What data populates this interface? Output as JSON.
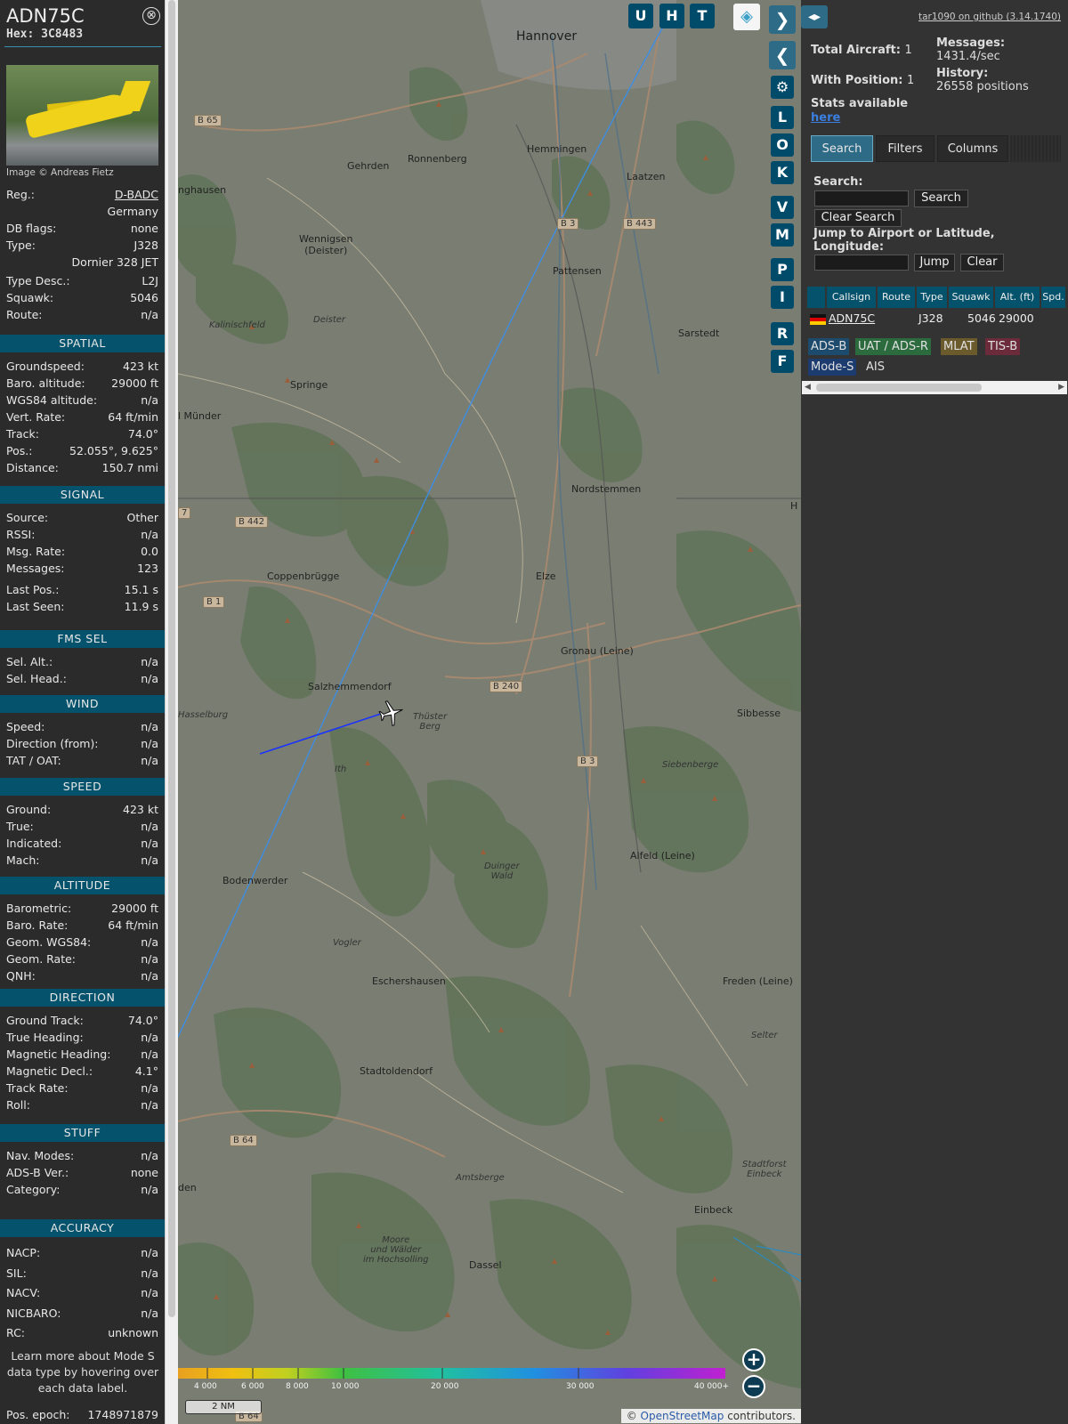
{
  "info": {
    "callsign": "ADN75C",
    "hex_label": "Hex:",
    "hex": "3C8483",
    "close_glyph": "⊗",
    "photo_credit": "Image © Andreas Fietz",
    "basic": [
      {
        "k": "Reg.:",
        "v": "D-BADC"
      },
      {
        "k": "",
        "v": "Germany"
      },
      {
        "k": "DB flags:",
        "v": "none"
      },
      {
        "k": "Type:",
        "v": "J328"
      },
      {
        "k": "",
        "v": "Dornier 328 JET"
      },
      {
        "k": "Type Desc.:",
        "v": "L2J"
      },
      {
        "k": "Squawk:",
        "v": "5046"
      },
      {
        "k": "Route:",
        "v": "n/a"
      }
    ],
    "sections": [
      {
        "title": "SPATIAL",
        "rows": [
          {
            "k": "Groundspeed:",
            "v": "423 kt"
          },
          {
            "k": "Baro. altitude:",
            "v": "29000 ft"
          },
          {
            "k": "WGS84 altitude:",
            "v": "n/a"
          },
          {
            "k": "Vert. Rate:",
            "v": "64 ft/min"
          },
          {
            "k": "Track:",
            "v": "74.0°"
          },
          {
            "k": "Pos.:",
            "v": "52.055°, 9.625°"
          },
          {
            "k": "Distance:",
            "v": "150.7 nmi"
          }
        ]
      },
      {
        "title": "SIGNAL",
        "rows": [
          {
            "k": "Source:",
            "v": "Other"
          },
          {
            "k": "RSSI:",
            "v": "n/a"
          },
          {
            "k": "Msg. Rate:",
            "v": "0.0"
          },
          {
            "k": "Messages:",
            "v": "123"
          },
          {
            "k": "Last Pos.:",
            "v": "15.1 s"
          },
          {
            "k": "Last Seen:",
            "v": "11.9 s"
          }
        ]
      },
      {
        "title": "FMS SEL",
        "rows": [
          {
            "k": "Sel. Alt.:",
            "v": "n/a"
          },
          {
            "k": "Sel. Head.:",
            "v": "n/a"
          }
        ]
      },
      {
        "title": "WIND",
        "rows": [
          {
            "k": "Speed:",
            "v": "n/a"
          },
          {
            "k": "Direction (from):",
            "v": "n/a"
          },
          {
            "k": "TAT / OAT:",
            "v": "n/a"
          }
        ]
      },
      {
        "title": "SPEED",
        "rows": [
          {
            "k": "Ground:",
            "v": "423 kt"
          },
          {
            "k": "True:",
            "v": "n/a"
          },
          {
            "k": "Indicated:",
            "v": "n/a"
          },
          {
            "k": "Mach:",
            "v": "n/a"
          }
        ]
      },
      {
        "title": "ALTITUDE",
        "rows": [
          {
            "k": "Barometric:",
            "v": "29000 ft"
          },
          {
            "k": "Baro. Rate:",
            "v": "64 ft/min"
          },
          {
            "k": "Geom. WGS84:",
            "v": "n/a"
          },
          {
            "k": "Geom. Rate:",
            "v": "n/a"
          },
          {
            "k": "QNH:",
            "v": "n/a"
          }
        ]
      },
      {
        "title": "DIRECTION",
        "rows": [
          {
            "k": "Ground Track:",
            "v": "74.0°"
          },
          {
            "k": "True Heading:",
            "v": "n/a"
          },
          {
            "k": "Magnetic Heading:",
            "v": "n/a"
          },
          {
            "k": "Magnetic Decl.:",
            "v": "4.1°"
          },
          {
            "k": "Track Rate:",
            "v": "n/a"
          },
          {
            "k": "Roll:",
            "v": "n/a"
          }
        ]
      },
      {
        "title": "STUFF",
        "rows": [
          {
            "k": "Nav. Modes:",
            "v": "n/a"
          },
          {
            "k": "ADS-B Ver.:",
            "v": "none"
          },
          {
            "k": "Category:",
            "v": "n/a"
          }
        ]
      },
      {
        "title": "ACCURACY",
        "rows": [
          {
            "k": "NACP:",
            "v": "n/a"
          },
          {
            "k": "SIL:",
            "v": "n/a"
          },
          {
            "k": "NACV:",
            "v": "n/a"
          },
          {
            "k": "NICBARO:",
            "v": "n/a"
          },
          {
            "k": "RC:",
            "v": "unknown"
          }
        ]
      }
    ],
    "learn_more": "Learn more about Mode S data type by hovering over each data label.",
    "epoch_label": "Pos. epoch:",
    "epoch_value": "1748971879"
  },
  "map": {
    "top_buttons": [
      "U",
      "H",
      "T"
    ],
    "side_buttons": [
      "L",
      "O",
      "K",
      "V",
      "M",
      "P",
      "I",
      "R",
      "F"
    ],
    "towns": [
      {
        "name": "Hannover",
        "big": true
      },
      {
        "name": "Hemmingen"
      },
      {
        "name": "Laatzen"
      },
      {
        "name": "Ronnenberg"
      },
      {
        "name": "Gehrden"
      },
      {
        "name": "nghausen"
      },
      {
        "name": "Wennigsen\n(Deister)"
      },
      {
        "name": "Pattensen"
      },
      {
        "name": "Sarstedt"
      },
      {
        "name": "Springe"
      },
      {
        "name": "l Münder"
      },
      {
        "name": "Nordstemmen"
      },
      {
        "name": "Coppenbrügge"
      },
      {
        "name": "Elze"
      },
      {
        "name": "Gronau (Leine)"
      },
      {
        "name": "Salzhemmendorf"
      },
      {
        "name": "Sibbesse"
      },
      {
        "name": "Alfeld (Leine)"
      },
      {
        "name": "Bodenwerder"
      },
      {
        "name": "Eschershausen"
      },
      {
        "name": "Freden (Leine)"
      },
      {
        "name": "Stadtoldendorf"
      },
      {
        "name": "Einbeck"
      },
      {
        "name": "Dassel"
      },
      {
        "name": "den"
      },
      {
        "name": "H"
      }
    ],
    "areas": [
      "Kalinischfeld",
      "Deister",
      "Hasselburg",
      "Thüster\nBerg",
      "Ith",
      "Siebenberge",
      "Duinger\nWald",
      "Vogler",
      "Selter",
      "Amtsberge",
      "Stadtforst\nEinbeck",
      "Moore\nund Wälder\nim Hochsolling"
    ],
    "roads": [
      "B 65",
      "B 3",
      "B 443",
      "B 442",
      "B 1",
      "B 240",
      "B 3",
      "B 64",
      "B 64",
      "7"
    ],
    "alt_labels": [
      "4 000",
      "6 000",
      "8 000",
      "10 000",
      "20 000",
      "30 000",
      "40 000+"
    ],
    "scale": "2 NM",
    "attribution_text": "OpenStreetMap",
    "attribution_prefix": "©",
    "attribution_suffix": "contributors."
  },
  "right": {
    "github": "tar1090 on github (3.14.1740)",
    "total_label": "Total Aircraft:",
    "total_value": "1",
    "withpos_label": "With Position:",
    "withpos_value": "1",
    "messages_label": "Messages:",
    "messages_value": "1431.4/sec",
    "history_label": "History:",
    "history_value": "26558 positions",
    "stats_text": "Stats available",
    "stats_link": "here",
    "tabs": [
      "Search",
      "Filters",
      "Columns"
    ],
    "search_label": "Search:",
    "search_btn": "Search",
    "clear_search_btn": "Clear Search",
    "jump_label": "Jump to Airport or Latitude, Longitude:",
    "jump_btn": "Jump",
    "clear_btn": "Clear",
    "columns": [
      "Callsign",
      "Route",
      "Type",
      "Squawk",
      "Alt. (ft)",
      "Spd."
    ],
    "rows": [
      {
        "callsign": "ADN75C",
        "route": "",
        "type": "J328",
        "squawk": "5046",
        "alt": "29000",
        "spd": ""
      }
    ],
    "chips": [
      {
        "label": "ADS-B",
        "bg": "#1c4b6e",
        "fg": "#e0e0e0"
      },
      {
        "label": "UAT / ADS-R",
        "bg": "#2b6b3e",
        "fg": "#e0e0e0"
      },
      {
        "label": "MLAT",
        "bg": "#6b5a2b",
        "fg": "#e0e0e0"
      },
      {
        "label": "TIS-B",
        "bg": "#6b2b3a",
        "fg": "#e0e0e0"
      },
      {
        "label": "Mode-S",
        "bg": "#1c3b6e",
        "fg": "#e0e0e0"
      },
      {
        "label": "AIS",
        "bg": "#333333",
        "fg": "#e0e0e0"
      }
    ]
  },
  "colors": {
    "section_bg": "#04526b",
    "accent": "#2e6b86",
    "track_low": "#1a33ff",
    "track_light": "#3b8fe8"
  }
}
